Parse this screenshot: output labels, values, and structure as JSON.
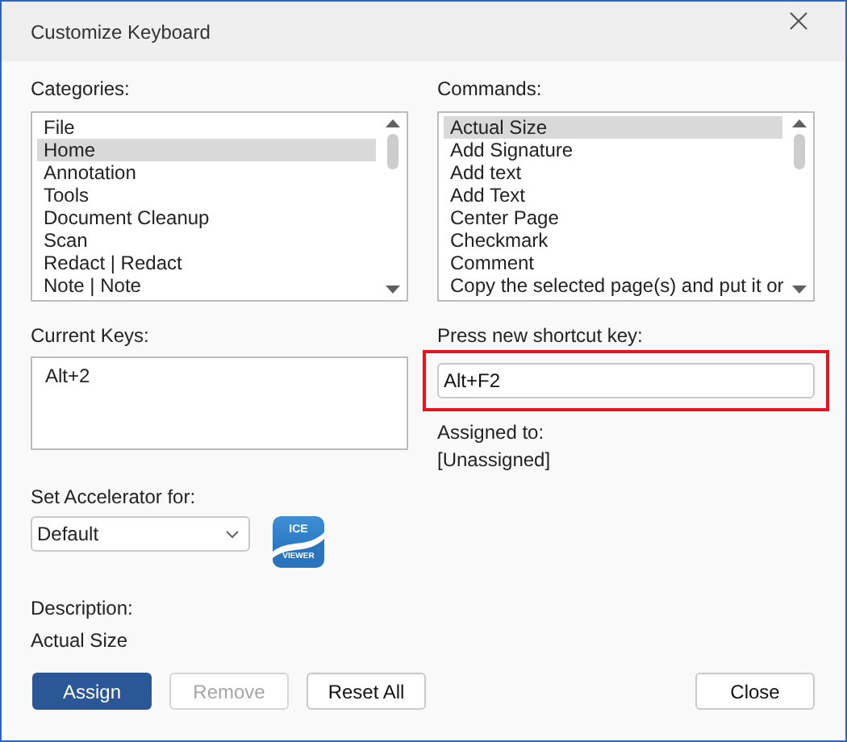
{
  "window": {
    "title": "Customize Keyboard"
  },
  "categories": {
    "label": "Categories:",
    "items": [
      {
        "label": "File",
        "selected": false
      },
      {
        "label": "Home",
        "selected": true
      },
      {
        "label": "Annotation",
        "selected": false
      },
      {
        "label": "Tools",
        "selected": false
      },
      {
        "label": "Document Cleanup",
        "selected": false
      },
      {
        "label": "Scan",
        "selected": false
      },
      {
        "label": "Redact | Redact",
        "selected": false
      },
      {
        "label": "Note | Note",
        "selected": false
      }
    ]
  },
  "commands": {
    "label": "Commands:",
    "items": [
      {
        "label": "Actual Size",
        "selected": true
      },
      {
        "label": "Add Signature",
        "selected": false
      },
      {
        "label": "Add text",
        "selected": false
      },
      {
        "label": "Add Text",
        "selected": false
      },
      {
        "label": "Center Page",
        "selected": false
      },
      {
        "label": "Checkmark",
        "selected": false
      },
      {
        "label": "Comment",
        "selected": false
      },
      {
        "label": "Copy the selected page(s) and put it or",
        "selected": false
      }
    ]
  },
  "current_keys": {
    "label": "Current Keys:",
    "items": [
      "Alt+2"
    ]
  },
  "new_shortcut": {
    "label": "Press new shortcut key:",
    "value": "Alt+F2",
    "highlighted": true
  },
  "assigned_to": {
    "label": "Assigned to:",
    "value": "[Unassigned]"
  },
  "accelerator": {
    "label": "Set Accelerator for:",
    "value": "Default"
  },
  "logo": {
    "top": "ICE",
    "bottom": "VIEWER"
  },
  "description": {
    "label": "Description:",
    "value": "Actual Size"
  },
  "buttons": [
    {
      "label": "Assign",
      "kind": "primary",
      "disabled": false
    },
    {
      "label": "Remove",
      "kind": "normal",
      "disabled": true
    },
    {
      "label": "Reset All",
      "kind": "normal",
      "disabled": false
    },
    {
      "label": "Close",
      "kind": "normal",
      "disabled": false
    }
  ]
}
